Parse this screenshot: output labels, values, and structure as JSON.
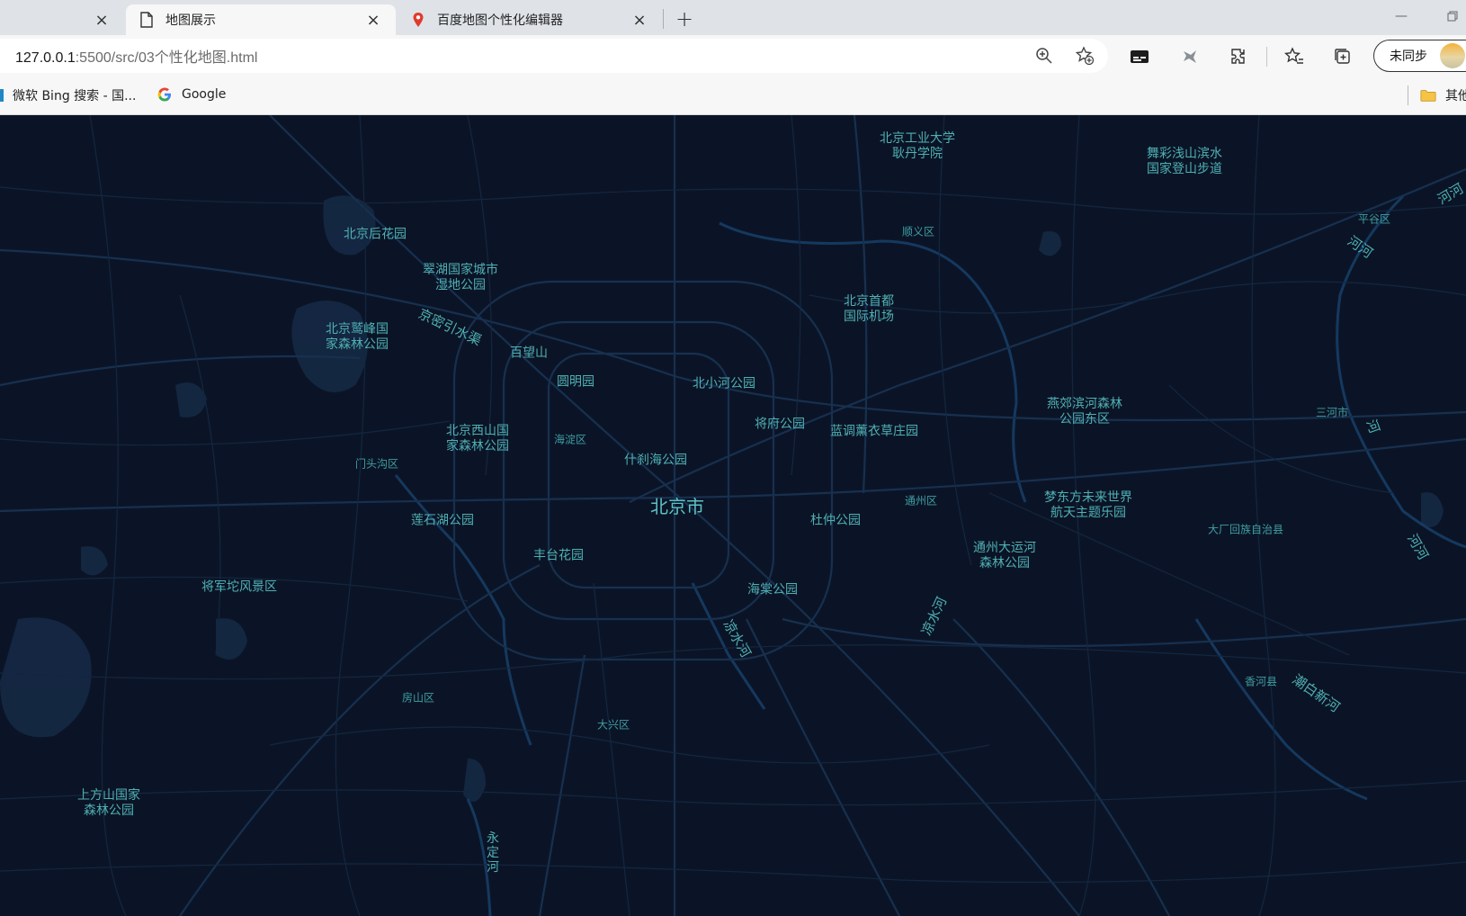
{
  "tabs": [
    {
      "label": "",
      "active": false
    },
    {
      "label": "地图展示",
      "active": true
    },
    {
      "label": "百度地图个性化编辑器",
      "active": false
    }
  ],
  "address_bar": {
    "host": "127.0.0.1",
    "rest": ":5500/src/03个性化地图.html"
  },
  "profile": {
    "label": "未同步"
  },
  "bookmarks": [
    {
      "label": "微软 Bing 搜索 - 国..."
    },
    {
      "label": "Google"
    },
    {
      "label": "其他"
    }
  ],
  "colors": {
    "map_background": "#0b1426",
    "road": "#16304f",
    "label": "#4fb1b4"
  },
  "map": {
    "city": "北京市",
    "labels": [
      {
        "id": "bjgy",
        "text": "北京工业大学\n耿丹学院"
      },
      {
        "id": "wuc",
        "text": "舞彩浅山滨水\n国家登山步道"
      },
      {
        "id": "hehe1",
        "text": "河河"
      },
      {
        "id": "pinggu",
        "text": "平谷区"
      },
      {
        "id": "hehe2",
        "text": "河河"
      },
      {
        "id": "shunyi",
        "text": "顺义区"
      },
      {
        "id": "bjhhy",
        "text": "北京后花园"
      },
      {
        "id": "cuihu",
        "text": "翠湖国家城市\n湿地公园"
      },
      {
        "id": "jmyz",
        "text": "京密引水渠"
      },
      {
        "id": "bjjf",
        "text": "北京鹫峰国\n家森林公园"
      },
      {
        "id": "airport",
        "text": "北京首都\n国际机场"
      },
      {
        "id": "bws",
        "text": "百望山"
      },
      {
        "id": "ymy",
        "text": "圆明园"
      },
      {
        "id": "bxh",
        "text": "北小河公园"
      },
      {
        "id": "yanjiao",
        "text": "燕郊滨河森林\n公园东区"
      },
      {
        "id": "sanhe",
        "text": "三河市"
      },
      {
        "id": "he3",
        "text": "河"
      },
      {
        "id": "jfgy",
        "text": "将府公园"
      },
      {
        "id": "ldxc",
        "text": "蓝调薰衣草庄园"
      },
      {
        "id": "bjxs",
        "text": "北京西山国\n家森林公园"
      },
      {
        "id": "haidian",
        "text": "海淀区"
      },
      {
        "id": "mentougou",
        "text": "门头沟区"
      },
      {
        "id": "shichahai",
        "text": "什刹海公园"
      },
      {
        "id": "tongzhou",
        "text": "通州区"
      },
      {
        "id": "mdf",
        "text": "梦东方未来世界\n航天主题乐园"
      },
      {
        "id": "lshu",
        "text": "莲石湖公园"
      },
      {
        "id": "dzgy",
        "text": "杜仲公园"
      },
      {
        "id": "dachang",
        "text": "大厂回族自治县"
      },
      {
        "id": "tzdyh",
        "text": "通州大运河\n森林公园"
      },
      {
        "id": "hehe3",
        "text": "河河"
      },
      {
        "id": "fthy",
        "text": "丰台花园"
      },
      {
        "id": "jjt",
        "text": "将军坨风景区"
      },
      {
        "id": "htgy",
        "text": "海棠公园"
      },
      {
        "id": "lsh1",
        "text": "凉水河"
      },
      {
        "id": "lsh2",
        "text": "凉水河"
      },
      {
        "id": "xianghe",
        "text": "香河县"
      },
      {
        "id": "cbx",
        "text": "潮白新河"
      },
      {
        "id": "fangshan",
        "text": "房山区"
      },
      {
        "id": "daxing",
        "text": "大兴区"
      },
      {
        "id": "sfs",
        "text": "上方山国家\n森林公园"
      },
      {
        "id": "ydh",
        "text": "永\n定\n河"
      }
    ]
  }
}
